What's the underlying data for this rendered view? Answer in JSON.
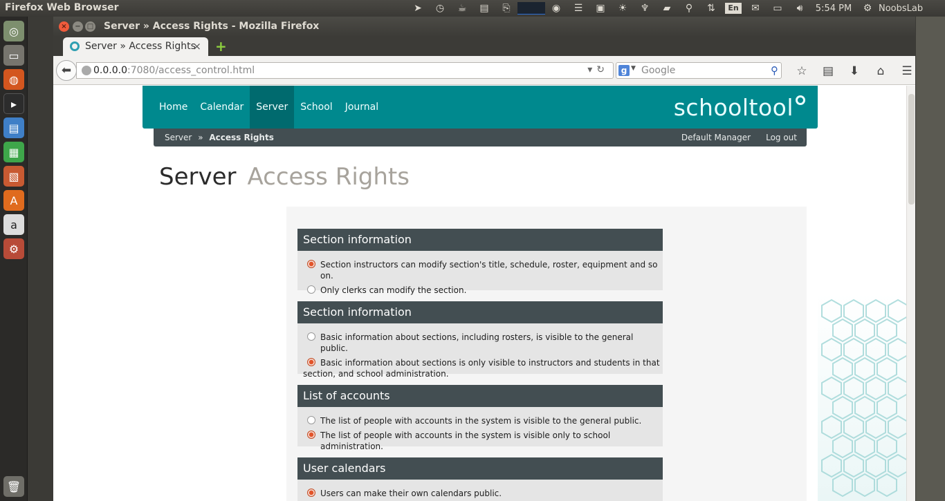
{
  "topPanel": {
    "appTitle": "Firefox Web Browser",
    "lang": "En",
    "clock": "5:54 PM",
    "user": "NoobsLab"
  },
  "window": {
    "title": "Server » Access Rights - Mozilla Firefox"
  },
  "tab": {
    "label": "Server » Access Rights",
    "close": "×",
    "newTab": "+"
  },
  "navbar": {
    "urlHost": "0.0.0.0",
    "urlPath": ":7080/access_control.html",
    "searchPlaceholder": "Google"
  },
  "site": {
    "nav": [
      "Home",
      "Calendar",
      "Server",
      "School",
      "Journal"
    ],
    "activeNav": "Server",
    "logo": "schooltool",
    "breadcrumb": {
      "parent": "Server",
      "sep": "»",
      "current": "Access Rights"
    },
    "userLinks": [
      "Default Manager",
      "Log out"
    ],
    "pageTitle": "Server",
    "pageSubtitle": "Access Rights"
  },
  "groups": [
    {
      "title": "Section information",
      "options": [
        {
          "label": "Section instructors can modify section's title, schedule, roster, equipment and so on.",
          "checked": true
        },
        {
          "label": "Only clerks can modify the section.",
          "checked": false
        }
      ]
    },
    {
      "title": "Section information",
      "options": [
        {
          "label": "Basic information about sections, including rosters, is visible to the general public.",
          "checked": false
        },
        {
          "label": "Basic information about sections is only visible to instructors and students in that section, and school administration.",
          "checked": true
        }
      ]
    },
    {
      "title": "List of accounts",
      "options": [
        {
          "label": "The list of people with accounts in the system is visible to the general public.",
          "checked": false
        },
        {
          "label": "The list of people with accounts in the system is visible only to school administration.",
          "checked": true
        }
      ]
    },
    {
      "title": "User calendars",
      "options": [
        {
          "label": "Users can make their own calendars public.",
          "checked": true
        }
      ]
    }
  ],
  "colors": {
    "headerTeal": "#00898e",
    "groupHeader": "#434e52",
    "radioOn": "#e2542a"
  }
}
